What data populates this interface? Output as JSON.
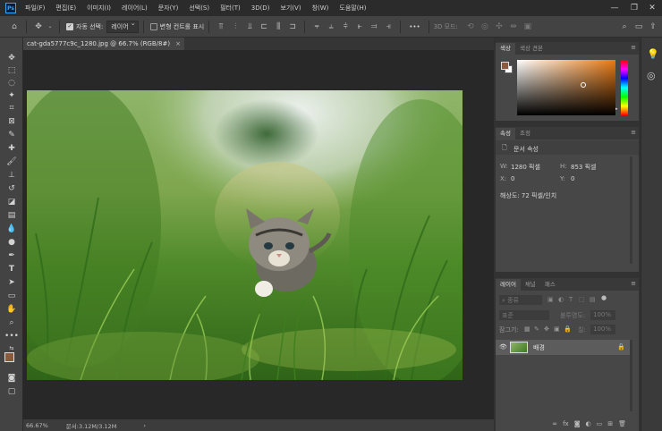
{
  "app": {
    "logo": "Ps"
  },
  "menu": [
    "파일(F)",
    "편집(E)",
    "이미지(I)",
    "레이어(L)",
    "문자(Y)",
    "선택(S)",
    "필터(T)",
    "3D(D)",
    "보기(V)",
    "창(W)",
    "도움말(H)"
  ],
  "options": {
    "auto_select_label": "자동 선택:",
    "auto_select_value": "레이어",
    "transform_label": "변형 컨트롤 표시",
    "mode_3d_label": "3D 모드:",
    "more": "•••"
  },
  "document": {
    "tab_title": "cat-gda5777c9c_1280.jpg @ 66.7% (RGB/8#)",
    "close": "×"
  },
  "status": {
    "zoom": "66.67%",
    "doc_info": "문서:3.12M/3.12M",
    "arrow": "›"
  },
  "color_panel": {
    "tabs": [
      "색상",
      "색상 견본"
    ],
    "foreground": "#8b5a3c",
    "hue": "#e87a13"
  },
  "properties_panel": {
    "tabs": [
      "속성",
      "조정"
    ],
    "section": "문서 속성",
    "w_label": "W:",
    "w_value": "1280 픽셀",
    "h_label": "H:",
    "h_value": "853 픽셀",
    "x_label": "X:",
    "x_value": "0",
    "y_label": "Y:",
    "y_value": "0",
    "resolution": "해상도: 72 픽셀/인치"
  },
  "layers_panel": {
    "tabs": [
      "레이어",
      "채널",
      "패스"
    ],
    "filter": "종류",
    "blend_mode": "표준",
    "opacity_label": "불투명도:",
    "opacity_value": "100%",
    "lock_label": "잠그기:",
    "fill_label": "칠:",
    "fill_value": "100%",
    "layer_name": "배경",
    "footer_icons": [
      "link-icon",
      "fx-icon",
      "mask-icon",
      "adjustment-icon",
      "group-icon",
      "new-layer-icon",
      "trash-icon"
    ]
  }
}
